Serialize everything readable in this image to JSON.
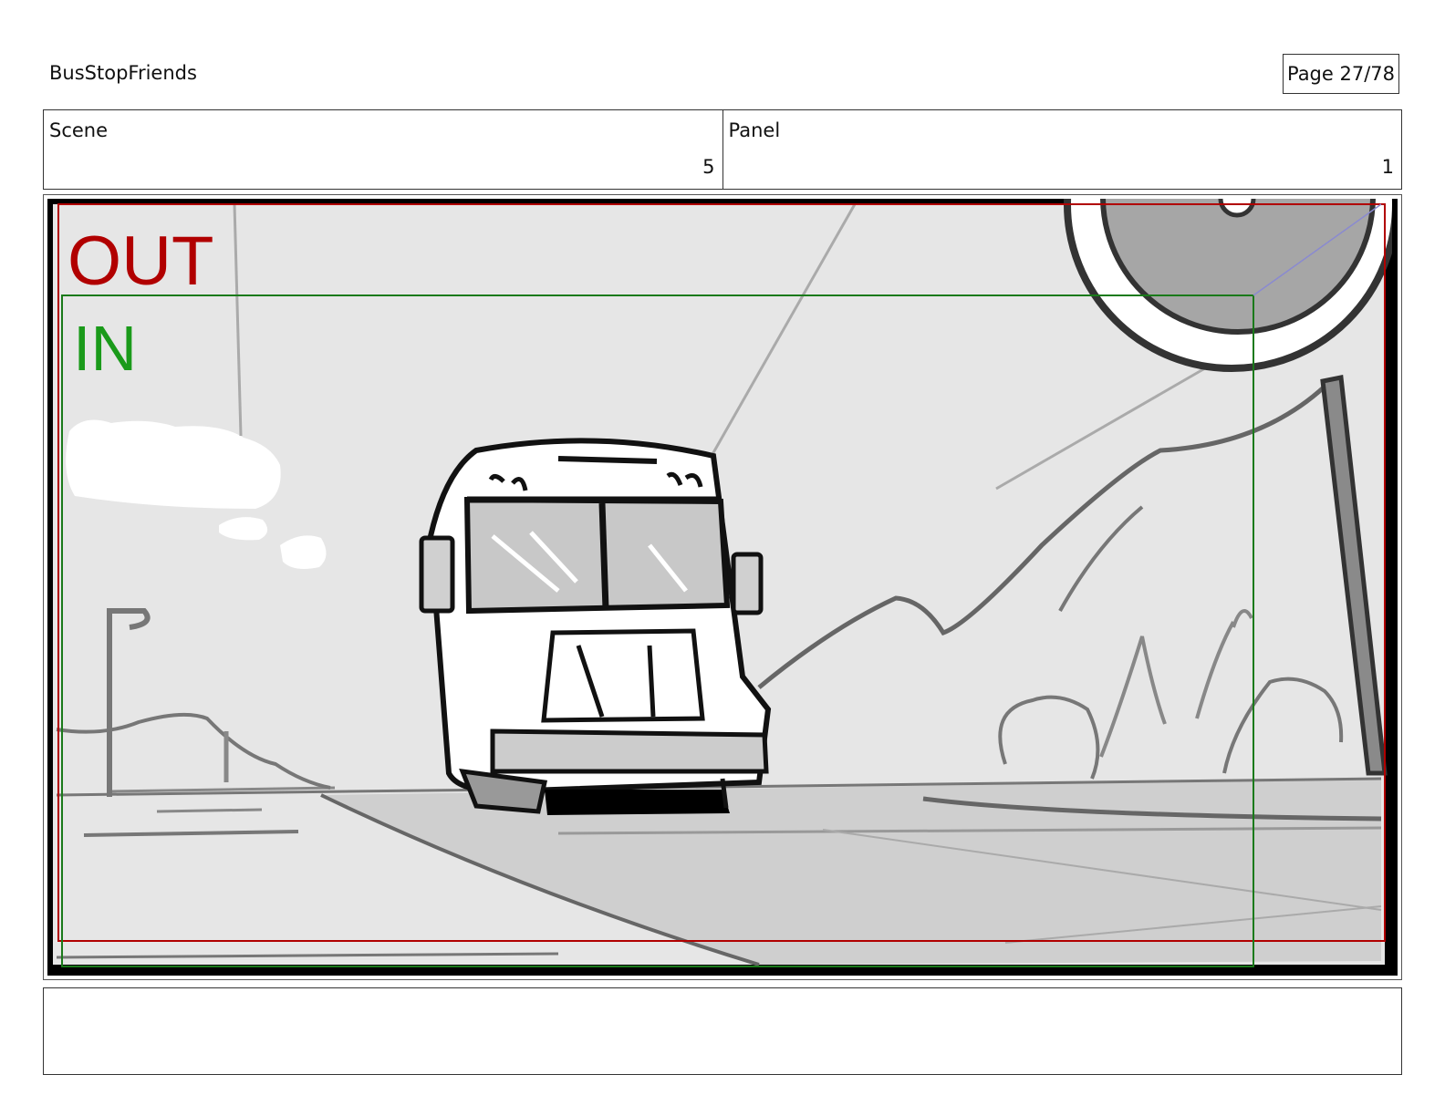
{
  "header": {
    "project_title": "BusStopFriends",
    "page_label": "Page 27/78"
  },
  "info": {
    "scene_label": "Scene",
    "scene_value": "5",
    "panel_label": "Panel",
    "panel_value": "1"
  },
  "frame": {
    "out_label": "OUT",
    "in_label": "IN",
    "colors": {
      "out": "#b10000",
      "in": "#1a9a1a"
    }
  },
  "notes": {
    "text": ""
  }
}
